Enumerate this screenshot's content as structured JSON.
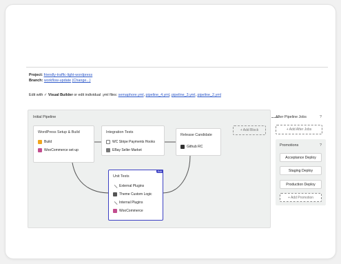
{
  "project": {
    "label": "Project:",
    "value": "friendly-traffic-light-wordpress"
  },
  "branch": {
    "label": "Branch:",
    "value": "workflow-update",
    "change": "(Change...)"
  },
  "edit": {
    "prefix": "Edit with",
    "visual": "✓ Visual Builder",
    "middle": "or edit individual .yml files:",
    "files": [
      "semaphore.yml",
      "pipeline_4.yml",
      "pipeline_3.yml",
      "pipeline_2.yml"
    ]
  },
  "pipeline": {
    "title": "Initial Pipeline",
    "add_block": "+ Add Block",
    "blocks": [
      {
        "title": "WordPress Setup & Build",
        "jobs": [
          {
            "name": "Build",
            "icon": "build-icon"
          },
          {
            "name": "WooCommerce set-up",
            "icon": "woocommerce-icon"
          }
        ]
      },
      {
        "title": "Integration Tests",
        "jobs": [
          {
            "name": "WC Stripe Payments Hooks",
            "icon": "stripe-icon"
          },
          {
            "name": "EBay Seller Market",
            "icon": "ebay-icon"
          }
        ]
      },
      {
        "title": "Release Candidate",
        "jobs": [
          {
            "name": "Github RC",
            "icon": "github-icon"
          }
        ]
      },
      {
        "title": "Unit Tests",
        "badge": "Edit",
        "jobs": [
          {
            "name": "External Plugins",
            "icon": "wrench-icon"
          },
          {
            "name": "Theme Custom Logic",
            "icon": "logic-icon"
          },
          {
            "name": "Internal Plugins",
            "icon": "wrench-icon"
          },
          {
            "name": "WooCommerce",
            "icon": "woocommerce-icon"
          }
        ]
      }
    ]
  },
  "after": {
    "title": "After Pipeline Jobs",
    "help": "?",
    "add": "+ Add After Jobs"
  },
  "promotions": {
    "title": "Promotions",
    "help": "?",
    "items": [
      "Acceptance Deploy",
      "Staging Deploy",
      "Production Deploy"
    ],
    "add": "+ Add Promotion"
  },
  "colors": {
    "link": "#2b57c9",
    "selected": "#3b3fc3",
    "canvas": "#eef0ef"
  }
}
